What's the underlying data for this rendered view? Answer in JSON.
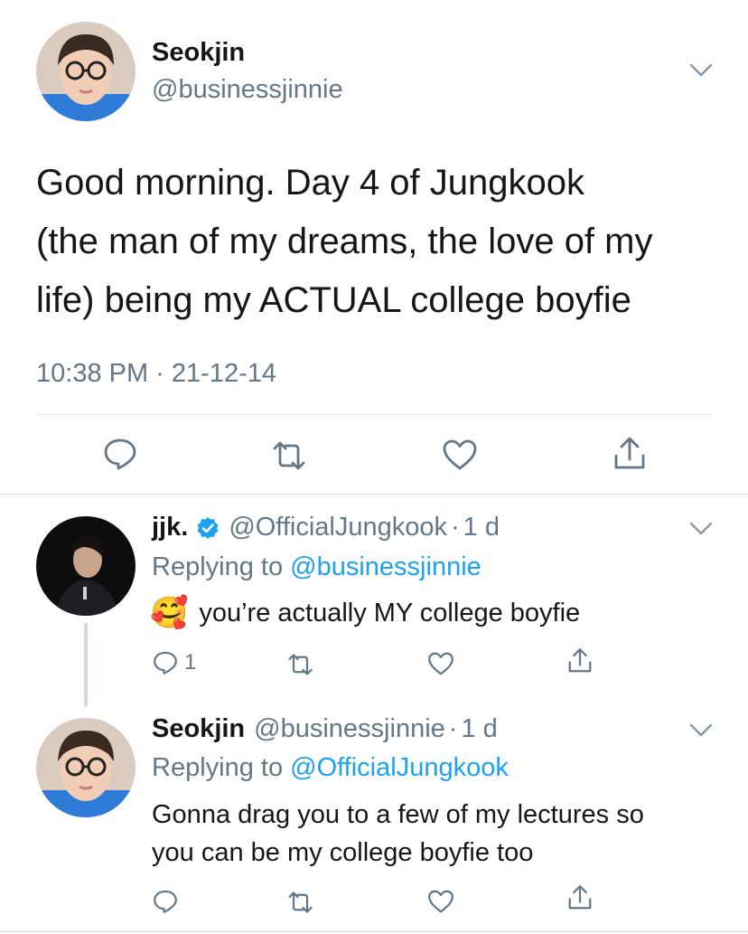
{
  "main_tweet": {
    "name": "Seokjin",
    "handle": "@businessjinnie",
    "text_lines": [
      "Good morning. Day 4 of Jungkook",
      "(the man of my dreams, the love of my",
      "life) being my ACTUAL college boyfie"
    ],
    "timestamp": "10:38 PM · 21-12-14",
    "icons": [
      "reply-icon",
      "retweet-icon",
      "like-icon",
      "share-icon"
    ]
  },
  "reply1": {
    "name": "jjk.",
    "handle": "@OfficialJungkook",
    "separator": "·",
    "time": "1 d",
    "replying_prefix": "Replying to",
    "replying_handle": "@businessjinnie",
    "emoji": "🥰",
    "text": "you’re actually MY college boyfie",
    "reply_count": "1"
  },
  "reply2": {
    "name": "Seokjin",
    "handle": "@businessjinnie",
    "separator": "·",
    "time": "1 d",
    "replying_prefix": "Replying to",
    "replying_handle": "@OfficialJungkook",
    "text_lines": [
      "Gonna drag you to a few of my lectures so",
      "you can be my college boyfie too"
    ]
  },
  "colors": {
    "text": "#14171a",
    "muted": "#657786",
    "link": "#1da1f2",
    "verified": "#1da1f2"
  }
}
